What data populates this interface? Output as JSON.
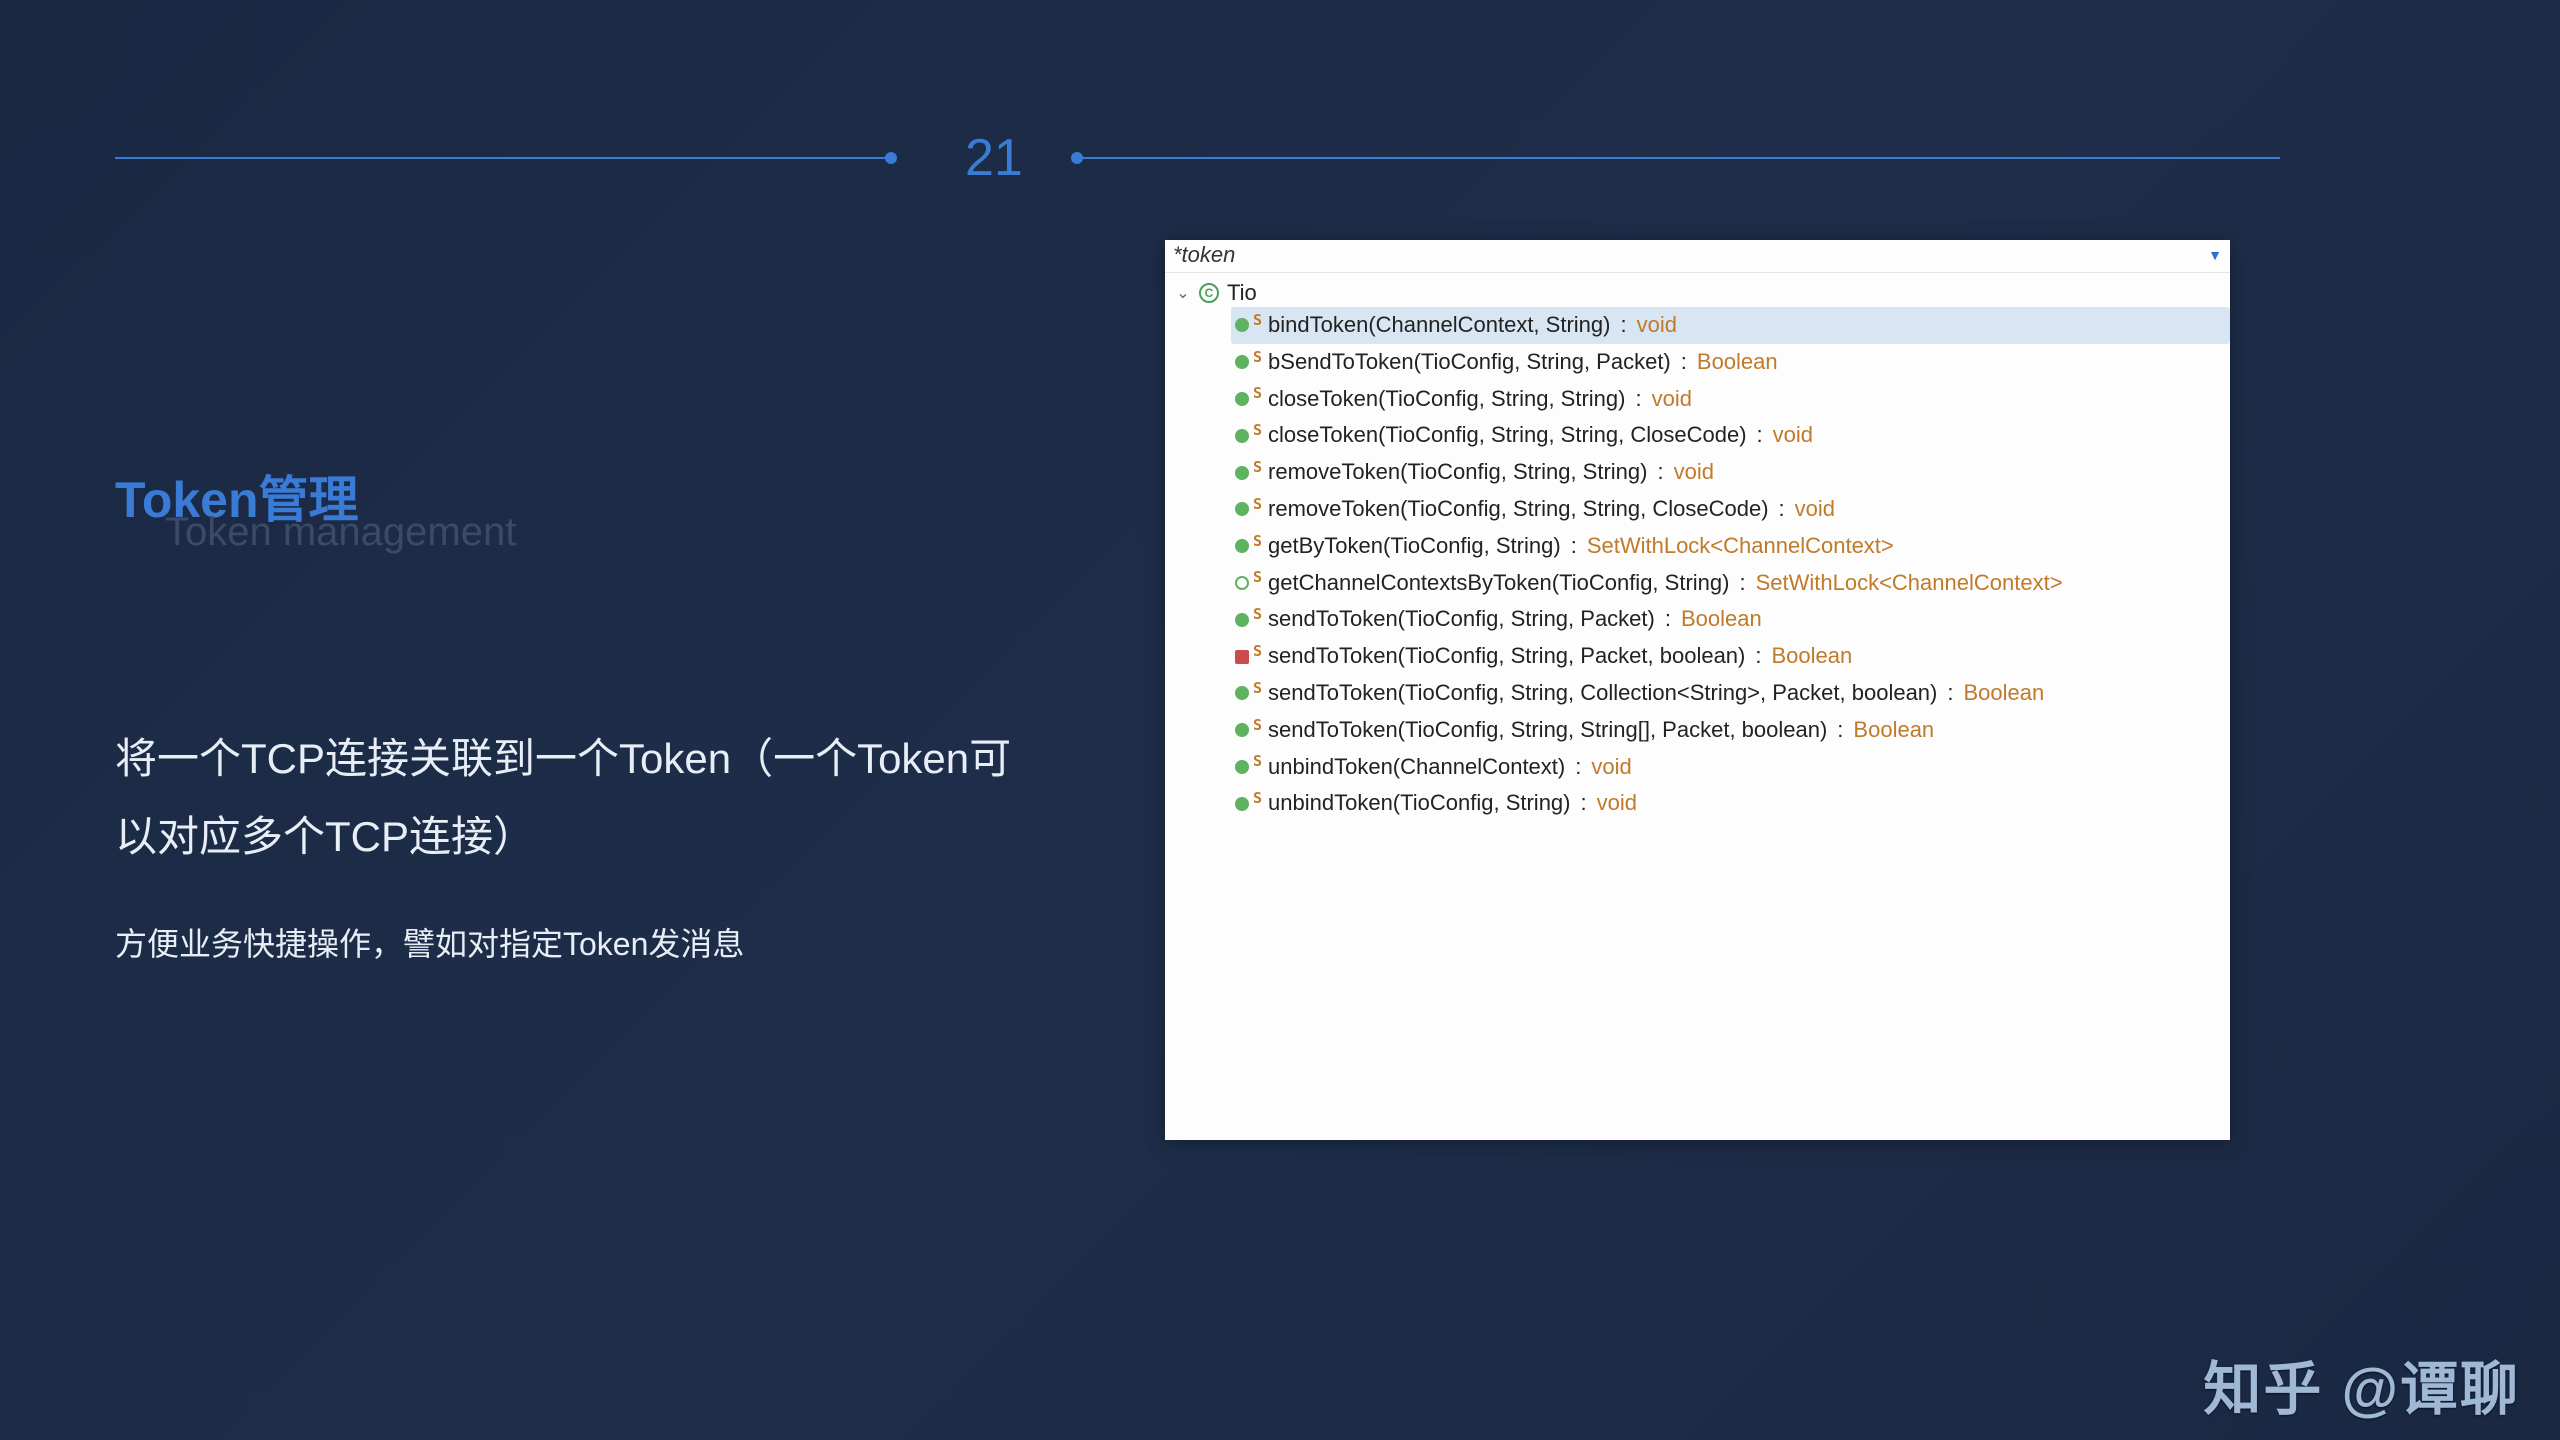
{
  "page_number": "21",
  "heading": {
    "title": "Token管理",
    "subtitle": "Token management"
  },
  "description": {
    "main": "将一个TCP连接关联到一个Token（一个Token可以对应多个TCP连接）",
    "sub": "方便业务快捷操作，譬如对指定Token发消息"
  },
  "ide": {
    "search_text": "*token",
    "class_name": "Tio",
    "methods": [
      {
        "icon": "green",
        "selected": true,
        "sig": "bindToken(ChannelContext, String)",
        "ret": "void"
      },
      {
        "icon": "green",
        "selected": false,
        "sig": "bSendToToken(TioConfig, String, Packet)",
        "ret": "Boolean"
      },
      {
        "icon": "green",
        "selected": false,
        "sig": "closeToken(TioConfig, String, String)",
        "ret": "void"
      },
      {
        "icon": "green",
        "selected": false,
        "sig": "closeToken(TioConfig, String, String, CloseCode)",
        "ret": "void"
      },
      {
        "icon": "green",
        "selected": false,
        "sig": "removeToken(TioConfig, String, String)",
        "ret": "void"
      },
      {
        "icon": "green",
        "selected": false,
        "sig": "removeToken(TioConfig, String, String, CloseCode)",
        "ret": "void"
      },
      {
        "icon": "green",
        "selected": false,
        "sig": "getByToken(TioConfig, String)",
        "ret": "SetWithLock<ChannelContext>"
      },
      {
        "icon": "greeno",
        "selected": false,
        "sig": "getChannelContextsByToken(TioConfig, String)",
        "ret": "SetWithLock<ChannelContext>"
      },
      {
        "icon": "green",
        "selected": false,
        "sig": "sendToToken(TioConfig, String, Packet)",
        "ret": "Boolean"
      },
      {
        "icon": "red",
        "selected": false,
        "sig": "sendToToken(TioConfig, String, Packet, boolean)",
        "ret": "Boolean"
      },
      {
        "icon": "green",
        "selected": false,
        "sig": "sendToToken(TioConfig, String, Collection<String>, Packet, boolean)",
        "ret": "Boolean"
      },
      {
        "icon": "green",
        "selected": false,
        "sig": "sendToToken(TioConfig, String, String[], Packet, boolean)",
        "ret": "Boolean"
      },
      {
        "icon": "green",
        "selected": false,
        "sig": "unbindToken(ChannelContext)",
        "ret": "void"
      },
      {
        "icon": "green",
        "selected": false,
        "sig": "unbindToken(TioConfig, String)",
        "ret": "void"
      }
    ]
  },
  "watermark": "知乎 @谭聊"
}
